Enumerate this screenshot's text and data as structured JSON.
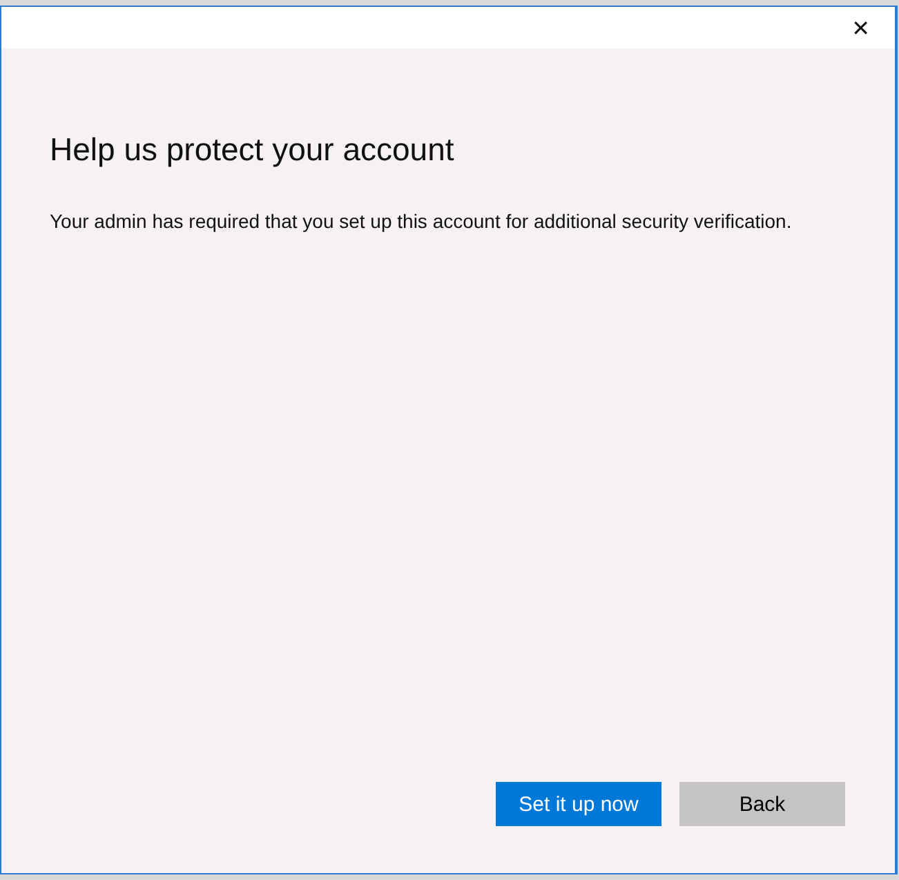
{
  "window": {
    "close": "✕"
  },
  "heading": "Help us protect your account",
  "message": "Your admin has required that you set up this account for additional security verification.",
  "buttons": [
    {
      "label": "Set it up now",
      "kind": "primary"
    },
    {
      "label": "Back",
      "kind": "secondary"
    }
  ]
}
